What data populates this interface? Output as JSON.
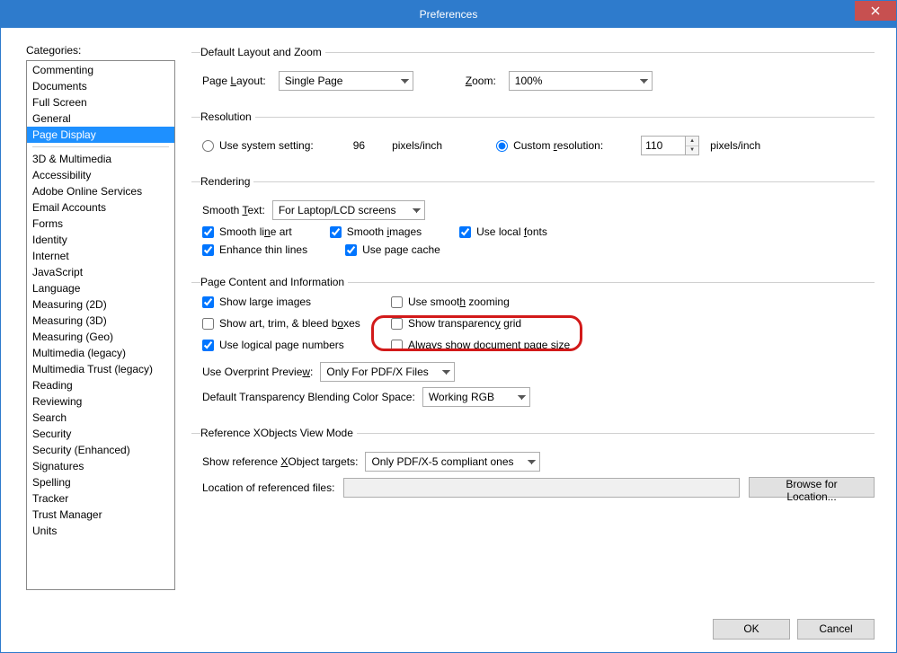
{
  "window": {
    "title": "Preferences"
  },
  "categories": {
    "label": "Categories:",
    "top": [
      "Commenting",
      "Documents",
      "Full Screen",
      "General",
      "Page Display"
    ],
    "selected": "Page Display",
    "rest": [
      "3D & Multimedia",
      "Accessibility",
      "Adobe Online Services",
      "Email Accounts",
      "Forms",
      "Identity",
      "Internet",
      "JavaScript",
      "Language",
      "Measuring (2D)",
      "Measuring (3D)",
      "Measuring (Geo)",
      "Multimedia (legacy)",
      "Multimedia Trust (legacy)",
      "Reading",
      "Reviewing",
      "Search",
      "Security",
      "Security (Enhanced)",
      "Signatures",
      "Spelling",
      "Tracker",
      "Trust Manager",
      "Units"
    ]
  },
  "layoutZoom": {
    "legend": "Default Layout and Zoom",
    "pageLayoutLabel": "Page Layout:",
    "pageLayoutValue": "Single Page",
    "zoomLabel": "Zoom:",
    "zoomValue": "100%"
  },
  "resolution": {
    "legend": "Resolution",
    "system": "Use system setting:",
    "systemValue": "96",
    "pixelsInch": "pixels/inch",
    "custom": "Custom resolution:",
    "customValue": "110"
  },
  "rendering": {
    "legend": "Rendering",
    "smoothTextLabel": "Smooth Text:",
    "smoothTextValue": "For Laptop/LCD screens",
    "checks": {
      "smoothLineArt": "Smooth line art",
      "smoothImages": "Smooth images",
      "useLocalFonts": "Use local fonts",
      "enhanceThinLines": "Enhance thin lines",
      "usePageCache": "Use page cache"
    }
  },
  "content": {
    "legend": "Page Content and Information",
    "showLargeImages": "Show large images",
    "smoothZooming": "Use smooth zooming",
    "artTrimBleed": "Show art, trim, & bleed boxes",
    "transparencyGrid": "Show transparency grid",
    "logicalPageNumbers": "Use logical page numbers",
    "alwaysShowDocSize": "Always show document page size",
    "overprintLabel": "Use Overprint Preview:",
    "overprintValue": "Only For PDF/X Files",
    "blendLabel": "Default Transparency Blending Color Space:",
    "blendValue": "Working RGB"
  },
  "xobjects": {
    "legend": "Reference XObjects View Mode",
    "showTargetsLabel": "Show reference XObject targets:",
    "showTargetsValue": "Only PDF/X-5 compliant ones",
    "locationLabel": "Location of referenced files:",
    "browse": "Browse for Location..."
  },
  "buttons": {
    "ok": "OK",
    "cancel": "Cancel"
  }
}
